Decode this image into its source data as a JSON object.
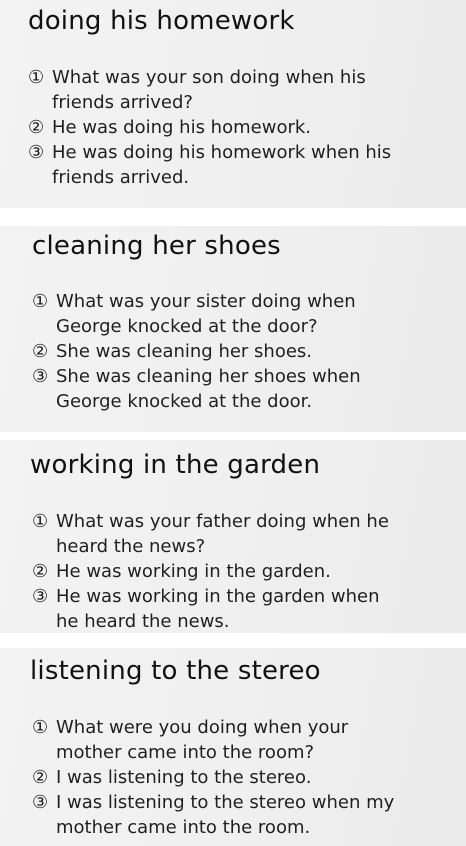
{
  "cards": [
    {
      "title": "doing his homework",
      "lines": [
        {
          "num": "①",
          "text": "What was your son doing when his"
        },
        {
          "num": "",
          "text": "friends arrived?"
        },
        {
          "num": "②",
          "text": "He was doing his homework."
        },
        {
          "num": "③",
          "text": "He was doing his homework when his"
        },
        {
          "num": "",
          "text": "friends arrived."
        }
      ]
    },
    {
      "title": "cleaning her shoes",
      "lines": [
        {
          "num": "①",
          "text": "What was your sister doing when"
        },
        {
          "num": "",
          "text": "George knocked at the door?"
        },
        {
          "num": "②",
          "text": "She was cleaning her shoes."
        },
        {
          "num": "③",
          "text": "She was cleaning her shoes when"
        },
        {
          "num": "",
          "text": "George knocked at the door."
        }
      ]
    },
    {
      "title": "working in the garden",
      "lines": [
        {
          "num": "①",
          "text": "What was your father doing when he"
        },
        {
          "num": "",
          "text": "heard the news?"
        },
        {
          "num": "②",
          "text": "He was working in the garden."
        },
        {
          "num": "③",
          "text": "He was working in the garden when"
        },
        {
          "num": "",
          "text": "he heard the news."
        }
      ]
    },
    {
      "title": "listening to the stereo",
      "lines": [
        {
          "num": "①",
          "text": "What were you doing when your"
        },
        {
          "num": "",
          "text": "mother came into the room?"
        },
        {
          "num": "②",
          "text": "I was listening to the stereo."
        },
        {
          "num": "③",
          "text": "I was listening to the stereo when my"
        },
        {
          "num": "",
          "text": "mother came into the room."
        }
      ]
    }
  ]
}
